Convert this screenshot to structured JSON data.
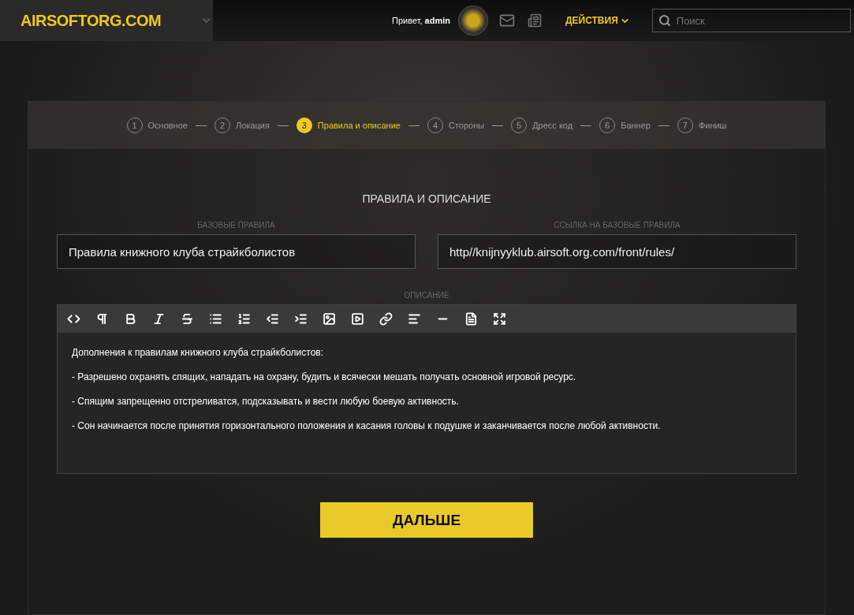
{
  "header": {
    "logo": "AIRSOFTORG.COM",
    "greeting": "Привет, **admin**",
    "actions": "ДЕЙСТВИЯ",
    "search_placeholder": "Поиск"
  },
  "steps": [
    {
      "number": "1",
      "label": "Основное",
      "selected": false
    },
    {
      "number": "2",
      "label": "Локация",
      "selected": false
    },
    {
      "number": "3",
      "label": "Правила и описание",
      "selected": true
    },
    {
      "number": "4",
      "label": "Стороны",
      "selected": false
    },
    {
      "number": "5",
      "label": "Дресс код",
      "selected": false
    },
    {
      "number": "6",
      "label": "Баннер",
      "selected": false
    },
    {
      "number": "7",
      "label": "Финиш",
      "selected": false
    }
  ],
  "section_title": "ПРАВИЛА И ОПИСАНИЕ",
  "fields": [
    {
      "label": "БАЗОВЫЕ ПРАВИЛА",
      "value": "Правила книжного клуба страйкболистов"
    },
    {
      "label": "ССЫЛКА НА БАЗОВЫЕ ПРАВИЛА",
      "value": "http//knijnyyklub.airsoft.org.com/front/rules/"
    }
  ],
  "description": {
    "label": "ОПИСАНИЕ",
    "paragraphs": [
      "Дополнения к правилам книжного клуба страйкболистов:",
      "- Разрешено охранять спящих, нападать на охрану, будить и всячески мешать получать основной игровой ресурс.",
      "- Спящим запрещенно отстреливатся, подсказывать и вести любую боевую активность.",
      "- Сон начинается после принятия горизонтального положения и касания головы к подушке и заканчивается после любой активности."
    ]
  },
  "next_button": "ДАЛЬШЕ"
}
